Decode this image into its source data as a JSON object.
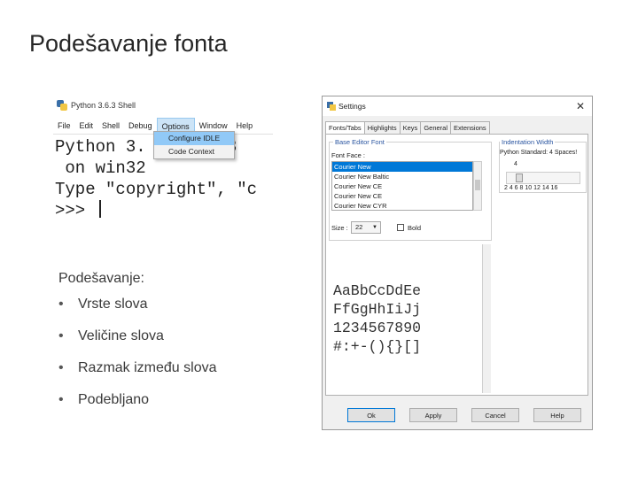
{
  "slide": {
    "title": "Podešavanje fonta",
    "intro": "Podešavanje:",
    "bullets": [
      "Vrste slova",
      "Veličine slova",
      "Razmak između slova",
      "Podebljano"
    ],
    "bullet_glyph": "•"
  },
  "shell": {
    "window_title": "Python 3.6.3 Shell",
    "menu": [
      "File",
      "Edit",
      "Shell",
      "Debug",
      "Options",
      "Window",
      "Help"
    ],
    "active_menu": "Options",
    "console_lines": [
      "Python 3.     .6.3",
      " on win32",
      "Type \"copyright\", \"c",
      ">>> "
    ],
    "dropdown": [
      "Configure IDLE",
      "Code Context"
    ]
  },
  "settings": {
    "window_title": "Settings",
    "close_glyph": "✕",
    "tabs": [
      "Fonts/Tabs",
      "Highlights",
      "Keys",
      "General",
      "Extensions"
    ],
    "active_tab": "Fonts/Tabs",
    "font_group_title": "Base Editor Font",
    "font_face_label": "Font Face :",
    "fonts": [
      "Courier New",
      "Courier New Baltic",
      "Courier New CE",
      "Courier New CE",
      "Courier New CYR"
    ],
    "selected_font": "Courier New",
    "size_label": "Size :",
    "size_value": "22",
    "bold_label": "Bold",
    "indent_group_title": "Indentation Width",
    "indent_standard": "Python Standard: 4 Spaces!",
    "indent_value": "4",
    "indent_ticks": "2  4  6  8  10 12 14 16",
    "sample_lines": [
      "AaBbCcDdEe",
      "FfGgHhIiJj",
      "1234567890",
      "#:+-(){}[]"
    ],
    "buttons": [
      "Ok",
      "Apply",
      "Cancel",
      "Help"
    ]
  }
}
